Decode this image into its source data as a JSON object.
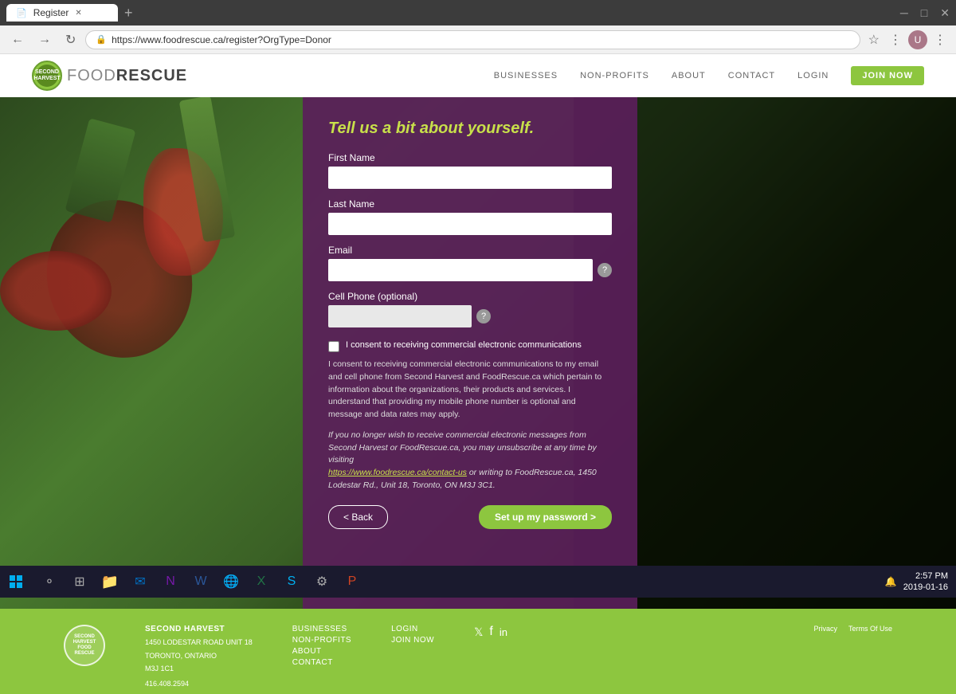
{
  "browser": {
    "tab_title": "Register",
    "url": "https://www.foodrescue.ca/register?OrgType=Donor",
    "back_label": "←",
    "forward_label": "→",
    "refresh_label": "↻"
  },
  "header": {
    "logo_text_normal": "FOOD",
    "logo_text_bold": "RESCUE",
    "nav": {
      "businesses": "BUSINESSES",
      "nonprofits": "NON-PROFITS",
      "about": "ABOUT",
      "contact": "CONTACT",
      "login": "LOGIN",
      "join_now": "JOIN NOW"
    }
  },
  "form": {
    "title": "Tell us a bit about yourself.",
    "first_name_label": "First Name",
    "last_name_label": "Last Name",
    "email_label": "Email",
    "cell_phone_label": "Cell Phone (optional)",
    "consent_checkbox_label": "I consent to receiving commercial electronic communications",
    "consent_body": "I consent to receiving commercial electronic communications to my email and cell phone from Second Harvest and FoodRescue.ca which pertain to information about the organizations, their products and services. I understand that providing my mobile phone number is optional and message and data rates may apply.",
    "consent_italic": "If you no longer wish to receive commercial electronic messages from Second Harvest or FoodRescue.ca, you may unsubscribe at any time by visiting",
    "consent_link_text": "https://www.foodrescue.ca/contact-us",
    "consent_link_suffix": " or writing to FoodRescue.ca, 1450 Lodestar Rd., Unit 18, Toronto, ON M3J 3C1.",
    "back_label": "< Back",
    "next_label": "Set up my password >"
  },
  "footer": {
    "org_name": "SECOND HARVEST",
    "address_line1": "1450 LODESTAR ROAD UNIT 18",
    "address_line2": "TORONTO, ONTARIO",
    "address_line3": "M3J 1C1",
    "phone": "416.408.2594",
    "nav_businesses": "BUSINESSES",
    "nav_nonprofits": "NON-PROFITS",
    "nav_about": "ABOUT",
    "nav_contact": "CONTACT",
    "nav_login": "LOGIN",
    "nav_join": "JOIN NOW",
    "privacy": "Privacy",
    "terms": "Terms Of Use"
  },
  "taskbar": {
    "time": "2:57 PM",
    "date": "2019-01-16"
  }
}
